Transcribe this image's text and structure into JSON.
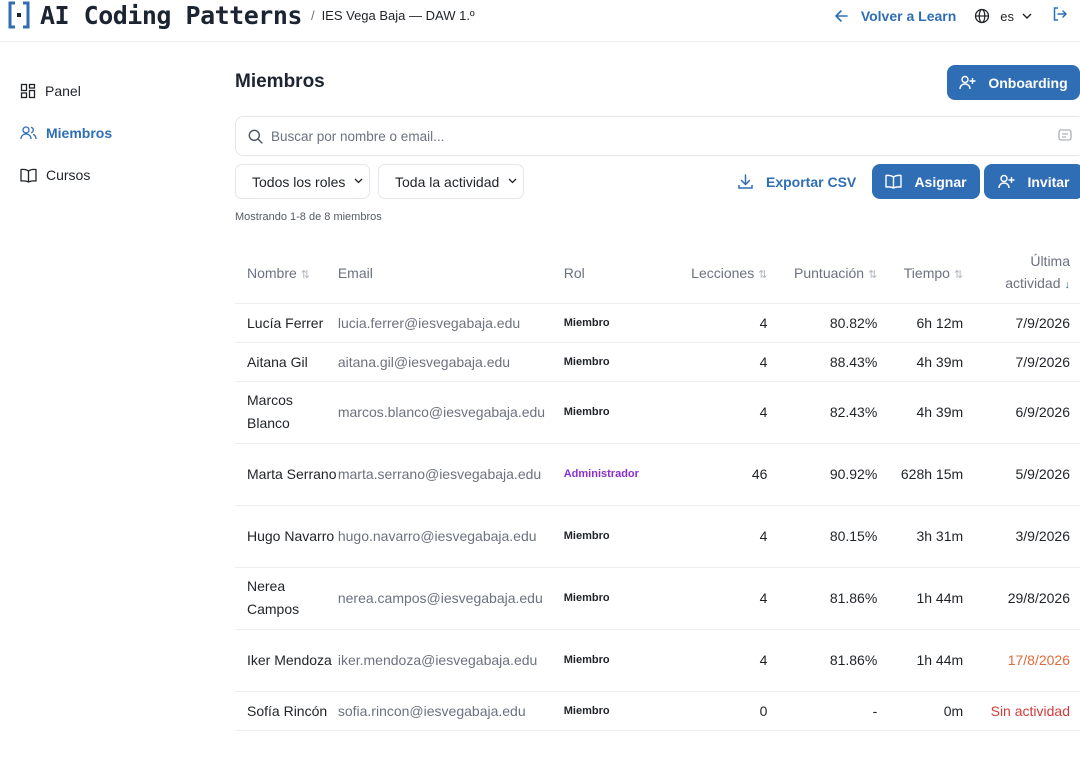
{
  "header": {
    "brand": "AI Coding Patterns",
    "breadcrumb_sep": "/",
    "breadcrumb": "IES Vega Baja — DAW 1.º",
    "back_label": "Volver a Learn",
    "language": "es"
  },
  "sidebar": {
    "items": [
      {
        "label": "Panel",
        "icon": "grid-icon"
      },
      {
        "label": "Miembros",
        "icon": "users-icon"
      },
      {
        "label": "Cursos",
        "icon": "book-icon"
      }
    ]
  },
  "main": {
    "title": "Miembros",
    "onboarding_label": "Onboarding",
    "search_placeholder": "Buscar por nombre o email...",
    "filter_roles": "Todos los roles",
    "filter_activity": "Toda la actividad",
    "export_label": "Exportar CSV",
    "assign_label": "Asignar",
    "invite_label": "Invitar",
    "showing": "Mostrando 1-8 de 8 miembros"
  },
  "table": {
    "headers": {
      "name": "Nombre",
      "email": "Email",
      "role": "Rol",
      "lessons": "Lecciones",
      "score": "Puntuación",
      "time": "Tiempo",
      "last_activity_1": "Última",
      "last_activity_2": "actividad"
    },
    "rows": [
      {
        "name": "Lucía Ferrer",
        "email": "lucia.ferrer@iesvegabaja.edu",
        "role": "Miembro",
        "lessons": "4",
        "score": "80.82%",
        "time": "6h 12m",
        "last": "7/9/2026"
      },
      {
        "name": "Aitana Gil",
        "email": "aitana.gil@iesvegabaja.edu",
        "role": "Miembro",
        "lessons": "4",
        "score": "88.43%",
        "time": "4h 39m",
        "last": "7/9/2026"
      },
      {
        "name": "Marcos Blanco",
        "email": "marcos.blanco@iesvegabaja.edu",
        "role": "Miembro",
        "lessons": "4",
        "score": "82.43%",
        "time": "4h 39m",
        "last": "6/9/2026"
      },
      {
        "name": "Marta Serrano",
        "email": "marta.serrano@iesvegabaja.edu",
        "role": "Administrador",
        "lessons": "46",
        "score": "90.92%",
        "time": "628h 15m",
        "last": "5/9/2026"
      },
      {
        "name": "Hugo Navarro",
        "email": "hugo.navarro@iesvegabaja.edu",
        "role": "Miembro",
        "lessons": "4",
        "score": "80.15%",
        "time": "3h 31m",
        "last": "3/9/2026"
      },
      {
        "name": "Nerea Campos",
        "email": "nerea.campos@iesvegabaja.edu",
        "role": "Miembro",
        "lessons": "4",
        "score": "81.86%",
        "time": "1h 44m",
        "last": "29/8/2026"
      },
      {
        "name": "Iker Mendoza",
        "email": "iker.mendoza@iesvegabaja.edu",
        "role": "Miembro",
        "lessons": "4",
        "score": "81.86%",
        "time": "1h 44m",
        "last": "17/8/2026"
      },
      {
        "name": "Sofía Rincón",
        "email": "sofia.rincon@iesvegabaja.edu",
        "role": "Miembro",
        "lessons": "0",
        "score": "-",
        "time": "0m",
        "last": "Sin actividad"
      }
    ]
  },
  "colors": {
    "accent": "#2f6eb5",
    "admin_role": "#8b2fd0",
    "stale_activity": "#e06a3b",
    "no_activity": "#d23b3b"
  }
}
